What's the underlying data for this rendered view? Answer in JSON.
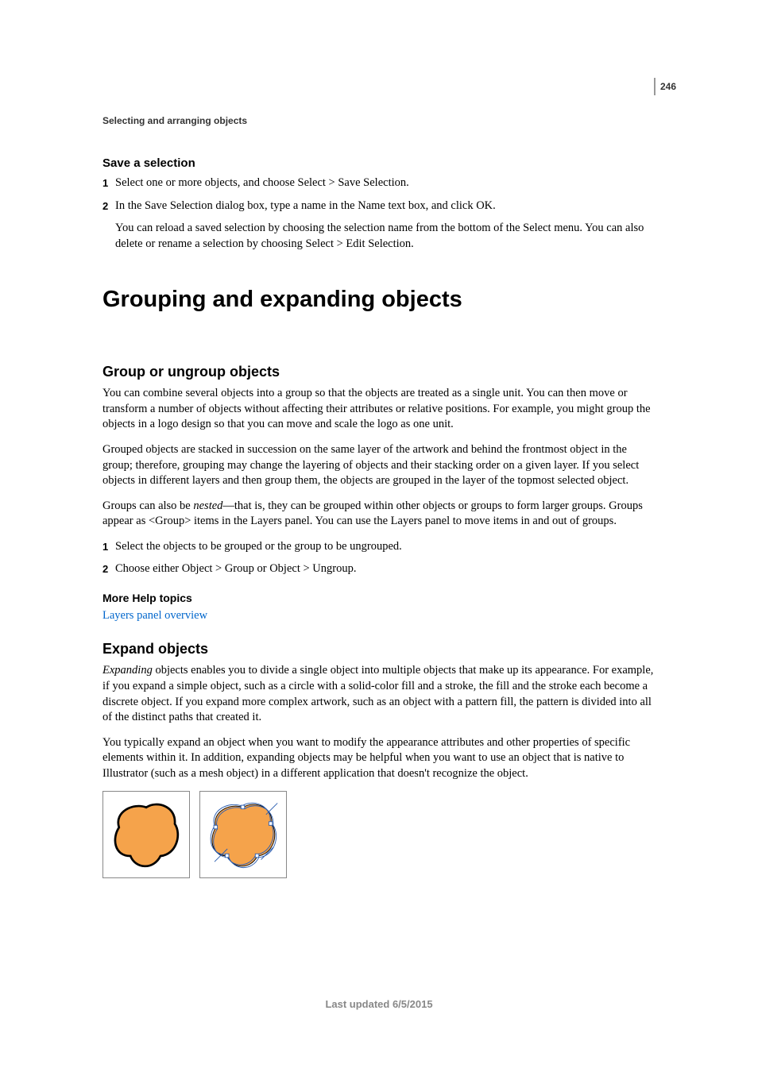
{
  "page_number": "246",
  "chapter_header": "Selecting and arranging objects",
  "sec1": {
    "heading": "Save a selection",
    "step1_num": "1",
    "step1_text": "Select one or more objects, and choose Select > Save Selection.",
    "step2_num": "2",
    "step2_text": "In the Save Selection dialog box, type a name in the Name text box, and click OK.",
    "step2_sub": "You can reload a saved selection by choosing the selection name from the bottom of the Select menu. You can also delete or rename a selection by choosing Select > Edit Selection."
  },
  "title": "Grouping and expanding objects",
  "sec2": {
    "heading": "Group or ungroup objects",
    "p1": "You can combine several objects into a group so that the objects are treated as a single unit. You can then move or transform a number of objects without affecting their attributes or relative positions. For example, you might group the objects in a logo design so that you can move and scale the logo as one unit.",
    "p2": "Grouped objects are stacked in succession on the same layer of the artwork and behind the frontmost object in the group; therefore, grouping may change the layering of objects and their stacking order on a given layer. If you select objects in different layers and then group them, the objects are grouped in the layer of the topmost selected object.",
    "p3_a": "Groups can also be ",
    "p3_i": "nested",
    "p3_b": "—that is, they can be grouped within other objects or groups to form larger groups. Groups appear as <Group> items in the Layers panel. You can use the Layers panel to move items in and out of groups.",
    "step1_num": "1",
    "step1_text": "Select the objects to be grouped or the group to be ungrouped.",
    "step2_num": "2",
    "step2_text": "Choose either Object > Group or Object > Ungroup.",
    "more_help": "More Help topics",
    "link1": "Layers panel overview"
  },
  "sec3": {
    "heading": "Expand objects",
    "p1_i": "Expanding",
    "p1_b": " objects enables you to divide a single object into multiple objects that make up its appearance. For example, if you expand a simple object, such as a circle with a solid-color fill and a stroke, the fill and the stroke each become a discrete object. If you expand more complex artwork, such as an object with a pattern fill, the pattern is divided into all of the distinct paths that created it.",
    "p2": "You typically expand an object when you want to modify the appearance attributes and other properties of specific elements within it. In addition, expanding objects may be helpful when you want to use an object that is native to Illustrator (such as a mesh object) in a different application that doesn't recognize the object."
  },
  "footer": "Last updated 6/5/2015"
}
